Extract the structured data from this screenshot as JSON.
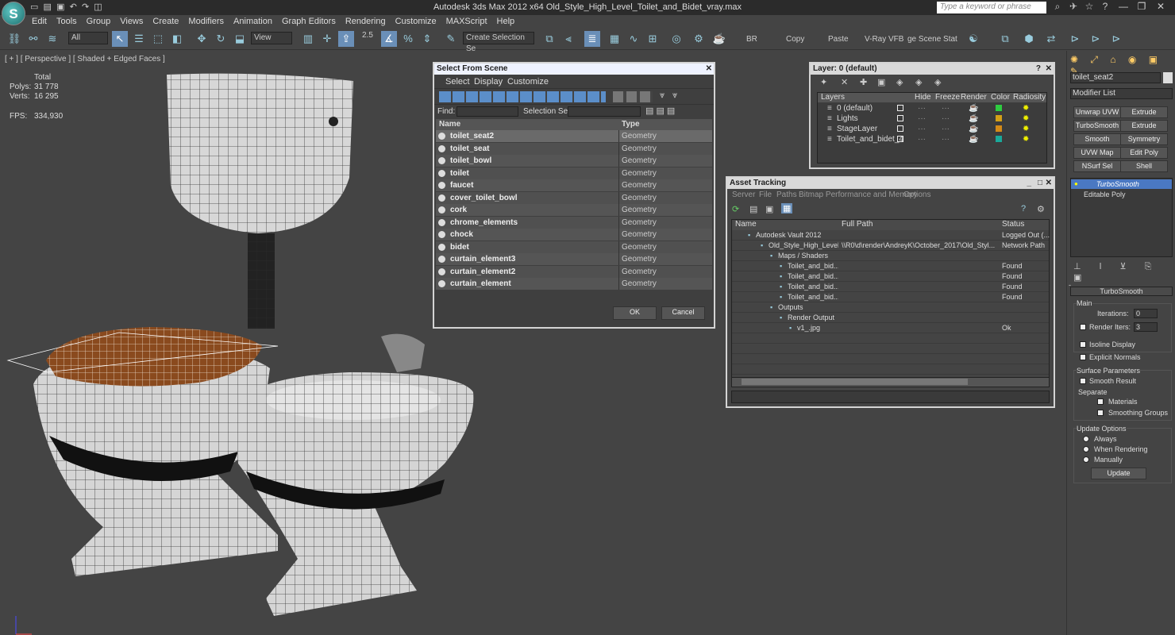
{
  "app": {
    "title": "Autodesk 3ds Max  2012 x64     Old_Style_High_Level_Toilet_and_Bidet_vray.max",
    "search_placeholder": "Type a keyword or phrase"
  },
  "menu": [
    "Edit",
    "Tools",
    "Group",
    "Views",
    "Create",
    "Modifiers",
    "Animation",
    "Graph Editors",
    "Rendering",
    "Customize",
    "MAXScript",
    "Help"
  ],
  "toolbar": {
    "filter": "All",
    "ref_coord": "View",
    "snap_value": "2.5",
    "selection_set": "Create Selection Se",
    "labels": {
      "br": "BR",
      "copy": "Copy",
      "paste": "Paste",
      "vfb": "V-Ray VFB",
      "stat": "ge Scene Stat"
    }
  },
  "viewport": {
    "label": "[ + ] [ Perspective ] [ Shaded + Edged Faces ]",
    "total": "Total",
    "polys_label": "Polys:",
    "polys": "31 778",
    "verts_label": "Verts:",
    "verts": "16 295",
    "fps_label": "FPS:",
    "fps": "334,930"
  },
  "select_scene": {
    "title": "Select From Scene",
    "menus": [
      "Select",
      "Display",
      "Customize"
    ],
    "find": "Find:",
    "selset": "Selection Set:",
    "col_name": "Name",
    "col_type": "Type",
    "rows": [
      {
        "name": "toilet_seat2",
        "type": "Geometry"
      },
      {
        "name": "toilet_seat",
        "type": "Geometry"
      },
      {
        "name": "toilet_bowl",
        "type": "Geometry"
      },
      {
        "name": "toilet",
        "type": "Geometry"
      },
      {
        "name": "faucet",
        "type": "Geometry"
      },
      {
        "name": "cover_toilet_bowl",
        "type": "Geometry"
      },
      {
        "name": "cork",
        "type": "Geometry"
      },
      {
        "name": "chrome_elements",
        "type": "Geometry"
      },
      {
        "name": "chock",
        "type": "Geometry"
      },
      {
        "name": "bidet",
        "type": "Geometry"
      },
      {
        "name": "curtain_element3",
        "type": "Geometry"
      },
      {
        "name": "curtain_element2",
        "type": "Geometry"
      },
      {
        "name": "curtain_element",
        "type": "Geometry"
      }
    ],
    "ok": "OK",
    "cancel": "Cancel"
  },
  "layer": {
    "title": "Layer: 0 (default)",
    "cols": [
      "Layers",
      "Hide",
      "Freeze",
      "Render",
      "Color",
      "Radiosity"
    ],
    "rows": [
      {
        "name": "0 (default)",
        "color": "#2ecc40"
      },
      {
        "name": "Lights",
        "color": "#d4a017"
      },
      {
        "name": "StageLayer",
        "color": "#d48a17"
      },
      {
        "name": "Toilet_and_bidet_4",
        "color": "#1aa99a"
      }
    ]
  },
  "asset": {
    "title": "Asset Tracking",
    "menus": [
      "Server",
      "File",
      "Paths",
      "Bitmap Performance and Memory",
      "Options"
    ],
    "cols": [
      "Name",
      "Full Path",
      "Status"
    ],
    "rows": [
      {
        "name": "Autodesk Vault 2012",
        "path": "",
        "status": "Logged Out (..."
      },
      {
        "name": "Old_Style_High_Level...",
        "path": "\\\\R0\\d\\render\\AndreyK\\October_2017\\Old_Styl...",
        "status": "Network Path"
      },
      {
        "name": "Maps / Shaders",
        "path": "",
        "status": ""
      },
      {
        "name": "Toilet_and_bid...",
        "path": "",
        "status": "Found"
      },
      {
        "name": "Toilet_and_bid...",
        "path": "",
        "status": "Found"
      },
      {
        "name": "Toilet_and_bid...",
        "path": "",
        "status": "Found"
      },
      {
        "name": "Toilet_and_bid...",
        "path": "",
        "status": "Found"
      },
      {
        "name": "Outputs",
        "path": "",
        "status": ""
      },
      {
        "name": "Render Output",
        "path": "",
        "status": ""
      },
      {
        "name": "v1_.jpg",
        "path": "",
        "status": "Ok"
      }
    ]
  },
  "cmd": {
    "object_name": "toilet_seat2",
    "modifier_list": "Modifier List",
    "buttons": [
      "Unwrap UVW",
      "Extrude",
      "TurboSmooth",
      "Extrude",
      "Smooth",
      "Symmetry",
      "UVW Map",
      "Edit Poly",
      "NSurf Sel",
      "Shell"
    ],
    "stack": [
      "TurboSmooth",
      "Editable Poly"
    ],
    "rollout": "TurboSmooth",
    "main": "Main",
    "iterations_label": "Iterations:",
    "iterations": "0",
    "render_iters_label": "Render Iters:",
    "render_iters": "3",
    "isoline": "Isoline Display",
    "explicit": "Explicit Normals",
    "surface": "Surface Parameters",
    "smooth_result": "Smooth Result",
    "separate": "Separate",
    "materials": "Materials",
    "smoothing": "Smoothing Groups",
    "update_opts": "Update Options",
    "always": "Always",
    "when_rendering": "When Rendering",
    "manually": "Manually",
    "update": "Update"
  }
}
